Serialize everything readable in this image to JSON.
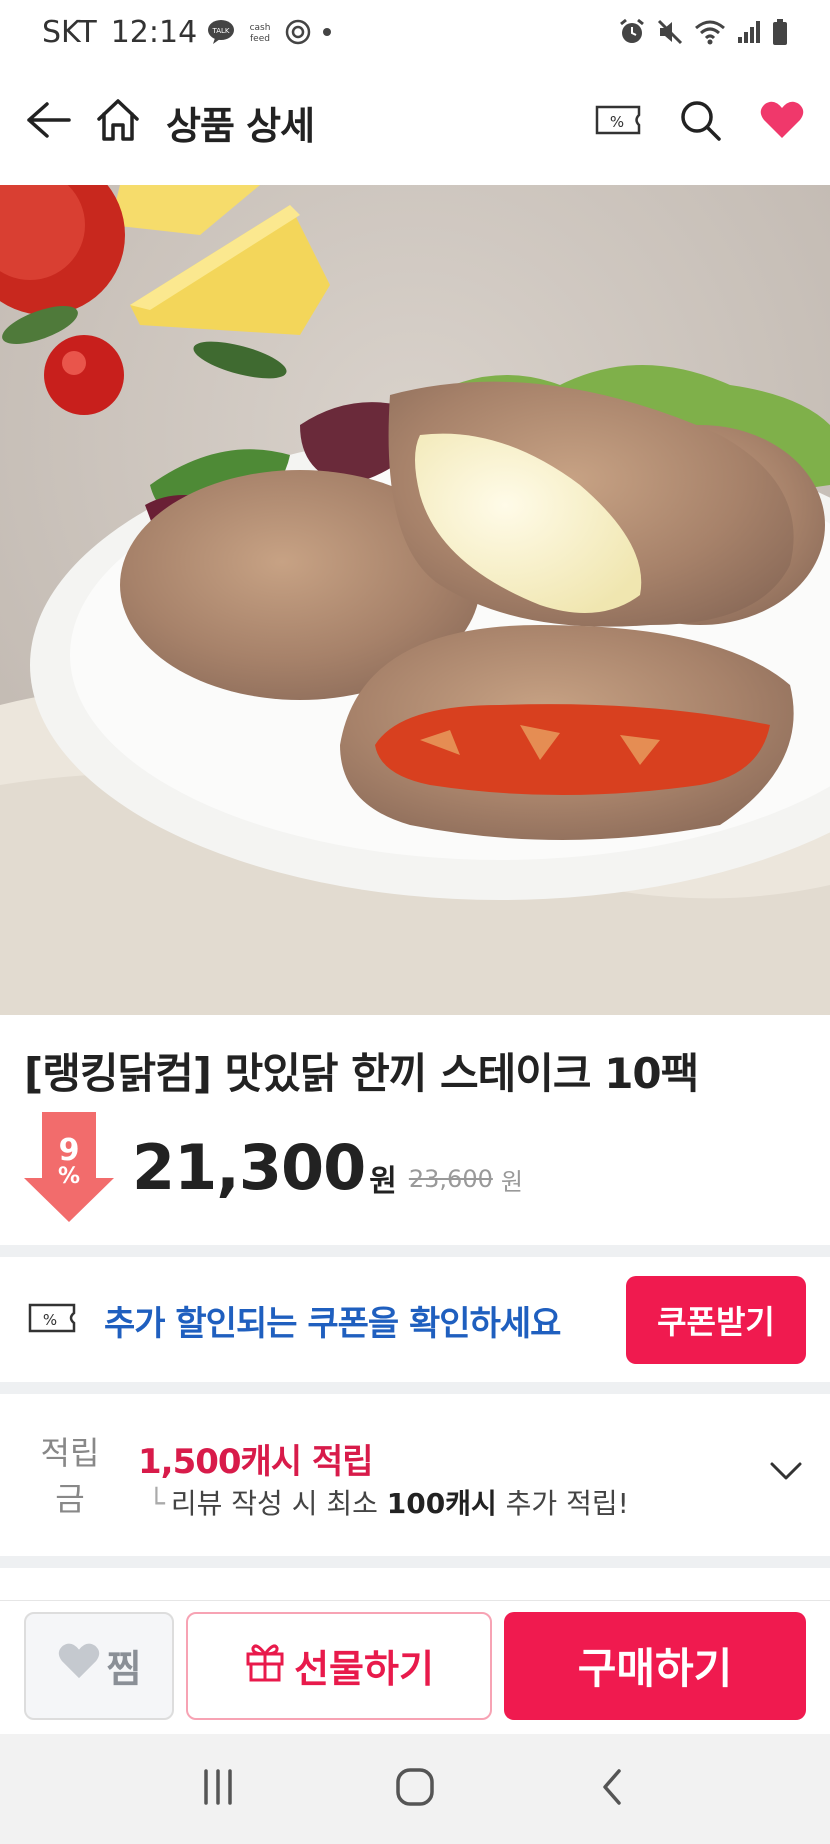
{
  "status_bar": {
    "carrier": "SKT",
    "time": "12:14",
    "icons": [
      "talk-icon",
      "cashfeed-icon",
      "ok-icon",
      "dot-icon",
      "alarm-icon",
      "mute-icon",
      "wifi-icon",
      "signal-icon",
      "battery-icon"
    ]
  },
  "header": {
    "title": "상품 상세",
    "icons": [
      "back-arrow-icon",
      "home-icon",
      "coupon-icon",
      "search-icon",
      "heart-icon"
    ],
    "accent": "#f0386b"
  },
  "product": {
    "image_subject": "chicken steak patties with cheese and tomato sauce on a plate",
    "title": "[랭킹닭컴] 맛있닭 한끼 스테이크 10팩",
    "discount_number": "9",
    "discount_unit": "%",
    "price": "21,300",
    "price_unit": "원",
    "original_price": "23,600",
    "original_price_unit": "원"
  },
  "coupon": {
    "icon": "coupon-icon",
    "text": "추가 할인되는 쿠폰을 확인하세요",
    "button": "쿠폰받기",
    "text_color": "#1f5fbf"
  },
  "points": {
    "label": "적립금",
    "main": "1,500캐시 적립",
    "sub_prefix": "리뷰 작성 시 최소",
    "sub_bold": "100캐시",
    "sub_suffix": "추가 적립!",
    "color": "#d81b4a"
  },
  "actions": {
    "wish_label": "찜",
    "gift_label": "선물하기",
    "buy_label": "구매하기",
    "brand_color": "#f01a4f"
  },
  "nav": {
    "icons": [
      "recent-apps-icon",
      "home-circle-icon",
      "back-chevron-icon"
    ]
  }
}
